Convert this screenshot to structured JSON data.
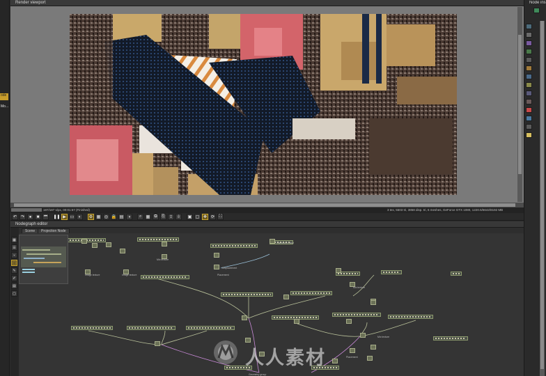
{
  "left_panel": {
    "tag_1": "ode",
    "tag_2": "Mo..."
  },
  "viewport": {
    "title": "Render viewport"
  },
  "status": {
    "progress_percent": 100,
    "left": "187/187 s/px, 00:01:57 (Finished)",
    "right": "3 tex, 5503 tri, 3858 disp. tri, 6 meshes, GeForce GTX 1080, 1220.5/6642/8192 MB"
  },
  "toolbar": {
    "icons": [
      "undo-icon",
      "redo-icon",
      "sphere-icon",
      "stop-icon",
      "rewind-icon",
      "pause-icon",
      "play-icon",
      "screen-icon",
      "clay-icon",
      "settings-icon",
      "region-icon",
      "focus-icon",
      "lock-icon",
      "film-icon",
      "lens-icon",
      "zoom-icon",
      "grid-icon",
      "copy-icon",
      "paste-icon",
      "export-icon",
      "import-icon",
      "save-icon",
      "cube-icon",
      "move-icon",
      "rotate-icon",
      "fit-icon"
    ]
  },
  "nodegraph": {
    "title": "Nodegraph editor",
    "tabs": [
      "Scene",
      "Projection Node"
    ],
    "side_icons": [
      "grid-icon",
      "stack-icon",
      "tree-icon",
      "select-icon",
      "wrench-icon",
      "pen-icon",
      "layer-icon",
      "box-icon"
    ]
  },
  "nodes": {
    "labels": [
      "Transform value",
      "Displacement",
      "Mix texture",
      "Placement",
      "Image texture",
      "Mix texture",
      "Image texture",
      "Geometry group",
      "Placement",
      "Mix texture"
    ]
  },
  "right_panel": {
    "title": "Node inspector",
    "icons": [
      "camera-icon",
      "sphere-icon",
      "material-icon",
      "texture-icon",
      "geometry-icon",
      "emission-icon",
      "medium-icon",
      "light-icon",
      "kernel-icon",
      "value-icon",
      "color-icon",
      "film-icon",
      "image-icon",
      "bulb-icon"
    ]
  },
  "watermark": {
    "text": "人人素材"
  }
}
